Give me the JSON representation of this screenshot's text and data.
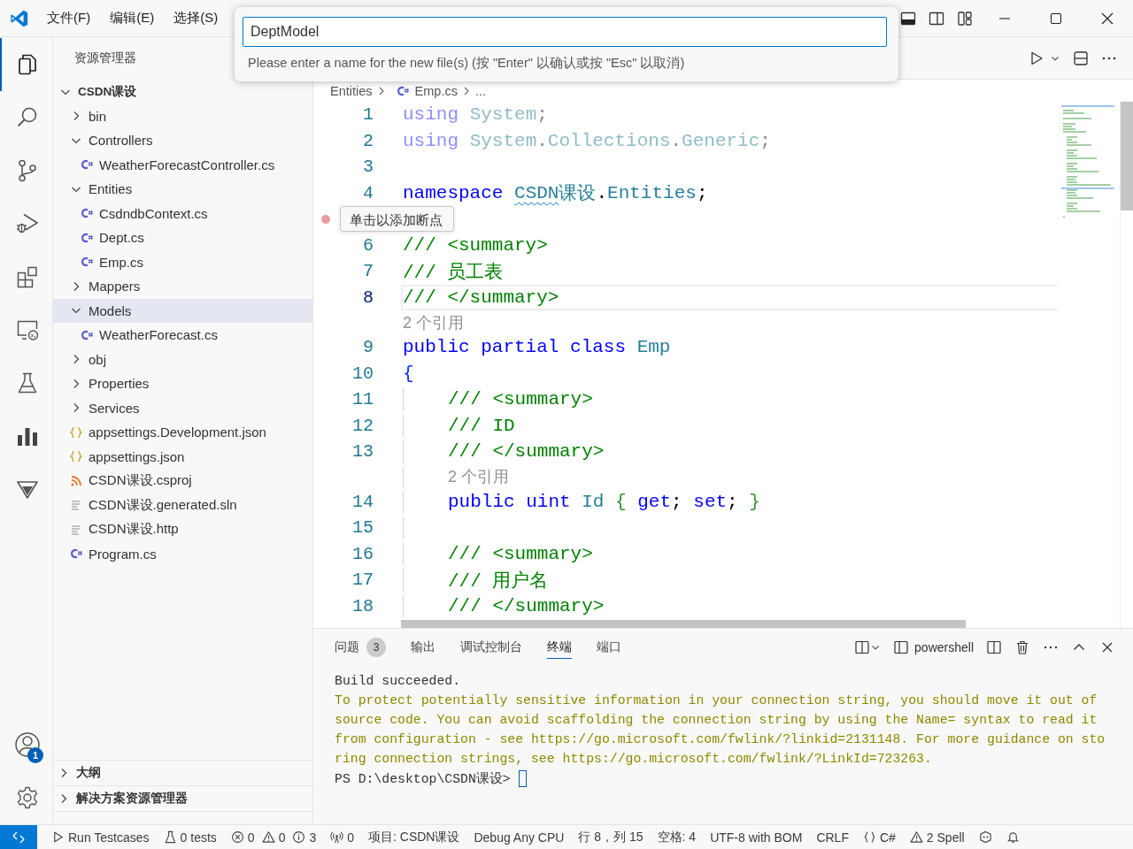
{
  "title_bar": {
    "menu": [
      "文件(F)",
      "编辑(E)",
      "选择(S)"
    ],
    "controls": [
      {
        "kind": "panel"
      },
      {
        "kind": "sidebar"
      },
      {
        "kind": "layout"
      },
      {
        "kind": "minimize"
      },
      {
        "kind": "maximize"
      },
      {
        "kind": "close"
      }
    ]
  },
  "quick_input": {
    "value": "DeptModel",
    "message": "Please enter a name for the new file(s) (按 \"Enter\" 以确认或按 \"Esc\" 以取消)"
  },
  "activity_bar": {
    "items": [
      {
        "kind": "files",
        "selected": true
      },
      {
        "kind": "search",
        "selected": false
      },
      {
        "kind": "source-control",
        "selected": false
      },
      {
        "kind": "run-debug",
        "selected": false
      },
      {
        "kind": "extensions",
        "selected": false
      },
      {
        "kind": "remote",
        "selected": false
      },
      {
        "kind": "flask",
        "selected": false
      },
      {
        "kind": "chart",
        "selected": false
      },
      {
        "kind": "funnel",
        "selected": false
      }
    ],
    "bottom": [
      {
        "kind": "account",
        "badge": "1"
      },
      {
        "kind": "gear"
      }
    ]
  },
  "sidebar": {
    "title": "资源管理器",
    "tree": [
      {
        "label": "CSDN课设",
        "kind": "project",
        "expanded": true,
        "selected": false,
        "children": [
          {
            "label": "bin",
            "kind": "folder",
            "expanded": false,
            "selected": false
          },
          {
            "label": "Controllers",
            "kind": "folder",
            "expanded": true,
            "selected": false,
            "children": [
              {
                "label": "WeatherForecastController.cs",
                "kind": "csharp",
                "selected": false
              }
            ]
          },
          {
            "label": "Entities",
            "kind": "folder",
            "expanded": true,
            "selected": false,
            "children": [
              {
                "label": "CsdndbContext.cs",
                "kind": "csharp",
                "selected": false
              },
              {
                "label": "Dept.cs",
                "kind": "csharp",
                "selected": false
              },
              {
                "label": "Emp.cs",
                "kind": "csharp",
                "selected": false
              }
            ]
          },
          {
            "label": "Mappers",
            "kind": "folder",
            "expanded": false,
            "selected": false
          },
          {
            "label": "Models",
            "kind": "folder",
            "expanded": true,
            "selected": true,
            "children": [
              {
                "label": "WeatherForecast.cs",
                "kind": "csharp",
                "selected": false
              }
            ]
          },
          {
            "label": "obj",
            "kind": "folder",
            "expanded": false,
            "selected": false
          },
          {
            "label": "Properties",
            "kind": "folder",
            "expanded": false,
            "selected": false
          },
          {
            "label": "Services",
            "kind": "folder",
            "expanded": false,
            "selected": false
          },
          {
            "label": "appsettings.Development.json",
            "kind": "json",
            "selected": false
          },
          {
            "label": "appsettings.json",
            "kind": "json",
            "selected": false
          },
          {
            "label": "CSDN课设.csproj",
            "kind": "rss",
            "selected": false
          },
          {
            "label": "CSDN课设.generated.sln",
            "kind": "lines",
            "selected": false
          },
          {
            "label": "CSDN课设.http",
            "kind": "lines",
            "selected": false
          },
          {
            "label": "Program.cs",
            "kind": "csharp",
            "selected": false
          }
        ]
      }
    ],
    "sections": [
      {
        "label": "大纲",
        "expanded": false
      },
      {
        "label": "解决方案资源管理器",
        "expanded": false
      }
    ]
  },
  "editor_toolbar": [
    {
      "kind": "run"
    },
    {
      "kind": "chevron"
    },
    {
      "kind": "split"
    },
    {
      "kind": "more"
    }
  ],
  "breadcrumb": [
    {
      "label": "Entities",
      "kind": "folder"
    },
    {
      "label": "Emp.cs",
      "kind": "csharp"
    },
    {
      "label": "...",
      "kind": "more"
    }
  ],
  "editor": {
    "tooltip": "单击以添加断点",
    "lines": [
      {
        "number": "1",
        "current": false,
        "hint": false,
        "indented": false,
        "tokens": [
          {
            "kind": "keyword-faded",
            "text": "using "
          },
          {
            "kind": "type-faded",
            "text": "System"
          },
          {
            "kind": "punct-faded",
            "text": ";"
          }
        ]
      },
      {
        "number": "2",
        "current": false,
        "hint": false,
        "indented": false,
        "tokens": [
          {
            "kind": "keyword-faded",
            "text": "using "
          },
          {
            "kind": "type-faded",
            "text": "System"
          },
          {
            "kind": "punct-faded",
            "text": "."
          },
          {
            "kind": "type-faded",
            "text": "Collections"
          },
          {
            "kind": "punct-faded",
            "text": "."
          },
          {
            "kind": "type-faded",
            "text": "Generic"
          },
          {
            "kind": "punct-faded",
            "text": ";"
          }
        ]
      },
      {
        "number": "3",
        "current": false,
        "hint": false,
        "indented": false
      },
      {
        "number": "4",
        "current": false,
        "hint": false,
        "indented": false,
        "tokens": [
          {
            "kind": "keyword",
            "text": "namespace "
          },
          {
            "kind": "type-error",
            "text": "CSDN"
          },
          {
            "kind": "type",
            "text": "课设"
          },
          {
            "kind": "punct",
            "text": "."
          },
          {
            "kind": "type",
            "text": "Entities"
          },
          {
            "kind": "punct",
            "text": ";"
          }
        ]
      },
      {
        "current": false,
        "hint": true,
        "indented": false
      },
      {
        "number": "6",
        "current": false,
        "hint": false,
        "indented": false,
        "tokens": [
          {
            "kind": "comment",
            "text": "/// <summary>"
          }
        ]
      },
      {
        "number": "7",
        "current": false,
        "hint": false,
        "indented": false,
        "tokens": [
          {
            "kind": "comment",
            "text": "/// 员工表"
          }
        ]
      },
      {
        "number": "8",
        "current": true,
        "hint": false,
        "indented": false,
        "tokens": [
          {
            "kind": "comment",
            "text": "/// </summary>"
          }
        ]
      },
      {
        "current": false,
        "hint": false,
        "indented": false,
        "tokens": [
          {
            "kind": "codelens",
            "text": "2 个引用"
          }
        ]
      },
      {
        "number": "9",
        "current": false,
        "hint": false,
        "indented": false,
        "tokens": [
          {
            "kind": "keyword",
            "text": "public partial class "
          },
          {
            "kind": "type",
            "text": "Emp"
          }
        ]
      },
      {
        "number": "10",
        "current": false,
        "hint": false,
        "indented": false,
        "tokens": [
          {
            "kind": "bracket1",
            "text": "{"
          }
        ]
      },
      {
        "number": "11",
        "current": false,
        "hint": false,
        "indented": true,
        "tokens": [
          {
            "kind": "comment",
            "text": "/// <summary>"
          }
        ]
      },
      {
        "number": "12",
        "current": false,
        "hint": false,
        "indented": true,
        "tokens": [
          {
            "kind": "comment",
            "text": "/// ID"
          }
        ]
      },
      {
        "number": "13",
        "current": false,
        "hint": false,
        "indented": true,
        "tokens": [
          {
            "kind": "comment",
            "text": "/// </summary>"
          }
        ]
      },
      {
        "current": false,
        "hint": false,
        "indented": true,
        "tokens": [
          {
            "kind": "codelens",
            "text": "2 个引用"
          }
        ]
      },
      {
        "number": "14",
        "current": false,
        "hint": false,
        "indented": true,
        "tokens": [
          {
            "kind": "keyword",
            "text": "public uint "
          },
          {
            "kind": "type",
            "text": "Id "
          },
          {
            "kind": "bracket2",
            "text": "{ "
          },
          {
            "kind": "keyword",
            "text": "get"
          },
          {
            "kind": "punct",
            "text": "; "
          },
          {
            "kind": "keyword",
            "text": "set"
          },
          {
            "kind": "punct",
            "text": "; "
          },
          {
            "kind": "bracket2",
            "text": "}"
          }
        ]
      },
      {
        "number": "15",
        "current": false,
        "hint": false,
        "indented": true
      },
      {
        "number": "16",
        "current": false,
        "hint": false,
        "indented": true,
        "tokens": [
          {
            "kind": "comment",
            "text": "/// <summary>"
          }
        ]
      },
      {
        "number": "17",
        "current": false,
        "hint": false,
        "indented": true,
        "tokens": [
          {
            "kind": "comment",
            "text": "/// 用户名"
          }
        ]
      },
      {
        "number": "18",
        "current": false,
        "hint": false,
        "indented": true,
        "tokens": [
          {
            "kind": "comment",
            "text": "/// </summary>"
          }
        ]
      }
    ]
  },
  "panel": {
    "tabs": [
      {
        "label": "问题",
        "badge": "3",
        "selected": false
      },
      {
        "label": "输出",
        "selected": false
      },
      {
        "label": "调试控制台",
        "selected": false
      },
      {
        "label": "终端",
        "selected": true
      },
      {
        "label": "端口",
        "selected": false
      }
    ],
    "actions": [
      {
        "kind": "layout"
      },
      {
        "kind": "terminal",
        "text": "powershell"
      },
      {
        "kind": "split"
      },
      {
        "kind": "trash"
      },
      {
        "kind": "more"
      },
      {
        "kind": "up"
      },
      {
        "kind": "close"
      }
    ],
    "output": [
      {
        "kind": "plain",
        "text": "Build succeeded."
      },
      {
        "kind": "warning",
        "text": "To protect potentially sensitive information in your connection string, you should move it out of"
      },
      {
        "kind": "warning",
        "text": "source code. You can avoid scaffolding the connection string by using the Name= syntax to read it"
      },
      {
        "kind": "warning",
        "text": "from configuration - see https://go.microsoft.com/fwlink/?linkid=2131148. For more guidance on sto"
      },
      {
        "kind": "warning",
        "text": "ring connection strings, see https://go.microsoft.com/fwlink/?LinkId=723263."
      },
      {
        "kind": "prompt",
        "text": "PS D:\\desktop\\CSDN课设> "
      }
    ]
  },
  "status_bar": {
    "items": [
      {
        "kind": "play",
        "text": "Run Testcases"
      },
      {
        "kind": "flask",
        "text": "0 tests"
      },
      {
        "kind": "error",
        "text": "0"
      },
      {
        "kind": "warning",
        "text": "0"
      },
      {
        "kind": "info",
        "text": "3"
      },
      {
        "kind": "broadcast",
        "text": "0"
      },
      {
        "text": "项目: CSDN课设"
      },
      {
        "text": "Debug Any CPU"
      },
      {
        "text": "行 8，列 15"
      },
      {
        "text": "空格: 4"
      },
      {
        "text": "UTF-8 with BOM"
      },
      {
        "text": "CRLF"
      },
      {
        "kind": "braces",
        "text": "C#"
      },
      {
        "kind": "warning",
        "text": "2 Spell"
      },
      {
        "kind": "copilot"
      },
      {
        "kind": "bell"
      }
    ]
  }
}
